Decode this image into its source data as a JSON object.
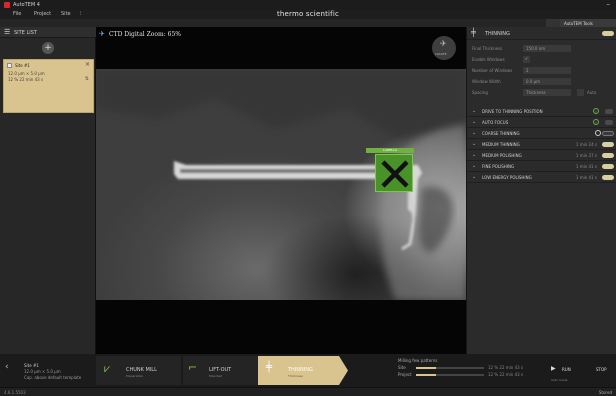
{
  "window": {
    "title": "AutoTEM 4",
    "brand": "thermo scientific"
  },
  "menu": {
    "file": "File",
    "project": "Project",
    "site": "Site"
  },
  "topright": {
    "autotem_label": "AutoTEM Tools"
  },
  "sidebar": {
    "header": "SITE LIST",
    "site": {
      "name": "Site #1",
      "size": "12.0 µm × 5.0 µm",
      "time": "12 %  22 min 43 s"
    }
  },
  "viewport": {
    "title": "CTD  Digital Zoom: 65%",
    "locate_label": "LOCATE",
    "marker_label": "LAMELLA"
  },
  "panel": {
    "title": "THINNING",
    "fields": [
      {
        "label": "Final Thickness",
        "value": "150.0 nm"
      },
      {
        "label": "Enable Windows",
        "value": "✓"
      },
      {
        "label": "Number of Windows",
        "value": "2"
      },
      {
        "label": "Window Width",
        "value": "0.0 µm"
      },
      {
        "label": "Spacing",
        "value": "Thickness"
      }
    ],
    "auto_label": "Auto",
    "steps": [
      {
        "label": "DRIVE TO THINNING POSITION",
        "time": "",
        "state": "check"
      },
      {
        "label": "AUTO FOCUS",
        "time": "",
        "state": "check"
      },
      {
        "label": "COARSE THINNING",
        "time": "",
        "state": "toggle-off"
      },
      {
        "label": "MEDIUM THINNING",
        "time": "1 min 24 s",
        "state": "toggle"
      },
      {
        "label": "MEDIUM POLISHING",
        "time": "1 min 37 s",
        "state": "toggle"
      },
      {
        "label": "FINE POLISHING",
        "time": "1 min 41 s",
        "state": "toggle"
      },
      {
        "label": "LOW ENERGY POLISHING",
        "time": "1 min 41 s",
        "state": "toggle"
      }
    ]
  },
  "bottom": {
    "site_name": "Site #1",
    "site_size": "12.0 µm × 5.0 µm",
    "site_template": "Cap. above default template",
    "stages": [
      {
        "label": "CHUNK MILL",
        "sub": "Preparation"
      },
      {
        "label": "LIFT-OUT",
        "sub": "Mounted"
      },
      {
        "label": "THINNING",
        "sub": "Thickness"
      }
    ],
    "progress": {
      "title": "Milling few patterns",
      "site_label": "Site",
      "project_label": "Project",
      "site_time": "12 %   22 min 43 s",
      "project_time": "12 %   22 min 43 s",
      "site_fraction": 0.3,
      "project_fraction": 0.3
    },
    "run_label": "RUN",
    "run_sub": "Auto mode",
    "stop_label": "STOP"
  },
  "status": {
    "left": "4.6.1.5503",
    "right": "Stored"
  }
}
